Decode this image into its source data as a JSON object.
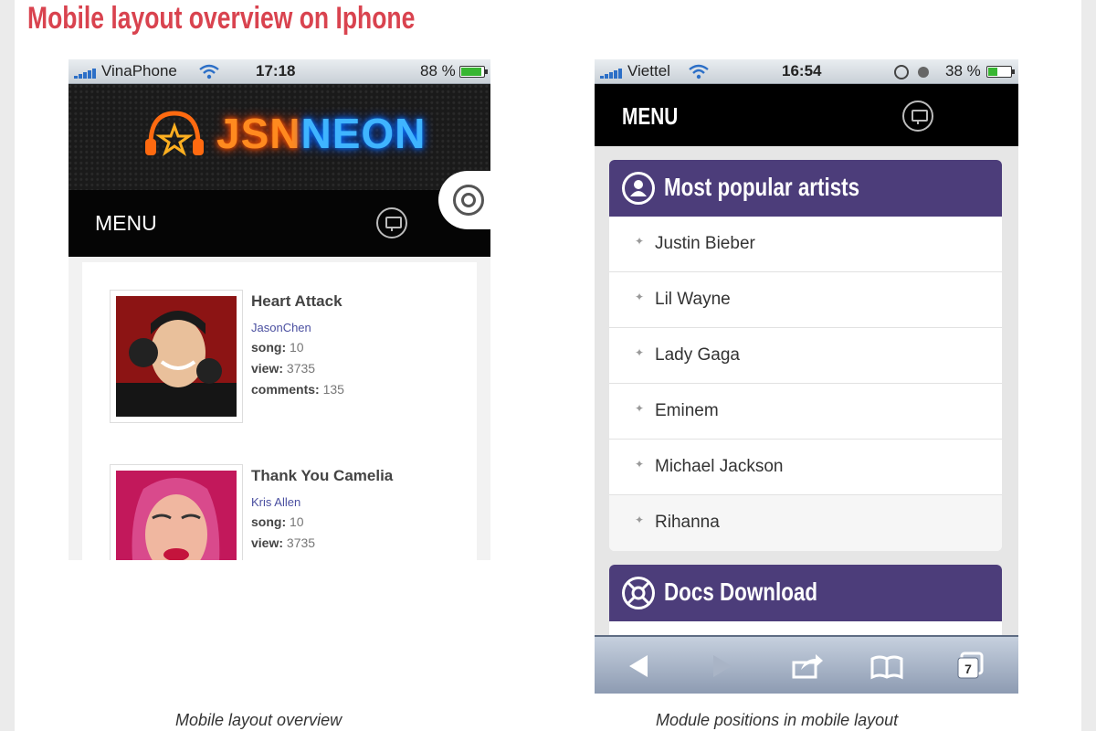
{
  "heading": "Mobile layout overview on Iphone",
  "phone1": {
    "status": {
      "carrier": "VinaPhone",
      "time": "17:18",
      "battery": "88 %"
    },
    "logo": {
      "part1": "JSN",
      "part2": "NEON"
    },
    "menu_label": "MENU",
    "songs": [
      {
        "title": "Heart Attack",
        "artist": "JasonChen",
        "song_label": "song:",
        "song_value": "10",
        "view_label": "view:",
        "view_value": "3735",
        "comments_label": "comments:",
        "comments_value": "135"
      },
      {
        "title": "Thank You Camelia",
        "artist": "Kris Allen",
        "song_label": "song:",
        "song_value": "10",
        "view_label": "view:",
        "view_value": "3735"
      }
    ],
    "caption": "Mobile layout overview"
  },
  "phone2": {
    "status": {
      "carrier": "Viettel",
      "time": "16:54",
      "battery": "38 %"
    },
    "menu_label": "MENU",
    "popular": {
      "title": "Most popular artists",
      "artists": [
        "Justin Bieber",
        "Lil Wayne",
        "Lady Gaga",
        "Eminem",
        "Michael Jackson",
        "Rihanna"
      ]
    },
    "docs": {
      "title": "Docs Download"
    },
    "toolbar": {
      "tabs_count": "7",
      "buttons": [
        "back-icon",
        "forward-icon",
        "share-icon",
        "bookmarks-icon",
        "tabs-icon"
      ]
    },
    "caption": "Module positions in mobile layout"
  },
  "colors": {
    "heading": "#d9434f",
    "panel": "#4c3d7a",
    "battery_green": "#38b632"
  }
}
